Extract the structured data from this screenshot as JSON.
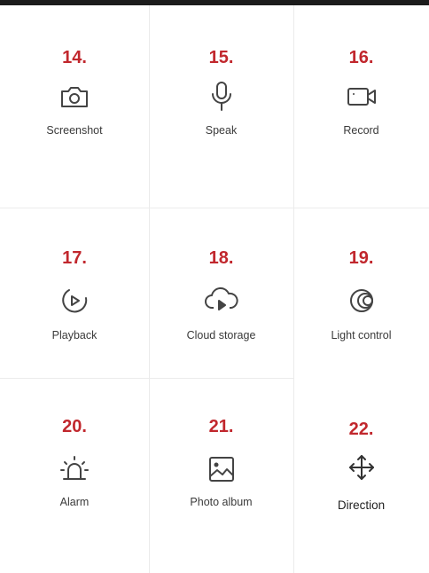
{
  "items": [
    {
      "number": "14.",
      "label": "Screenshot",
      "icon": "camera-icon"
    },
    {
      "number": "15.",
      "label": "Speak",
      "icon": "microphone-icon"
    },
    {
      "number": "16.",
      "label": "Record",
      "icon": "video-camera-icon"
    },
    {
      "number": "17.",
      "label": "Playback",
      "icon": "playback-icon"
    },
    {
      "number": "18.",
      "label": "Cloud storage",
      "icon": "cloud-play-icon"
    },
    {
      "number": "19.",
      "label": "Light control",
      "icon": "eye-icon"
    },
    {
      "number": "20.",
      "label": "Alarm",
      "icon": "alarm-siren-icon"
    },
    {
      "number": "21.",
      "label": "Photo album",
      "icon": "image-icon"
    },
    {
      "number": "22.",
      "label": "Direction",
      "icon": "move-arrows-icon"
    }
  ],
  "colors": {
    "number": "#c1272d",
    "icon": "#444444",
    "label": "#3a3a3a",
    "divider": "#ebebeb"
  }
}
